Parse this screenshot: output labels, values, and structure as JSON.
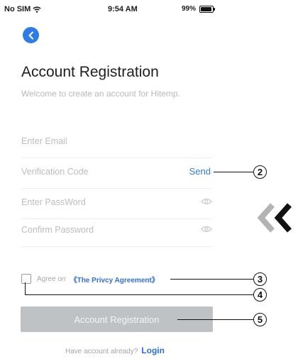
{
  "status_bar": {
    "carrier": "No SIM",
    "time": "9:54 AM",
    "battery": "99%"
  },
  "header": {
    "title": "Account Registration",
    "subtitle": "Welcome to create an account for Hitemp."
  },
  "form": {
    "email_placeholder": "Enter Email",
    "verification_placeholder": "Verification Code",
    "send_label": "Send",
    "password_placeholder": "Enter PassWord",
    "confirm_placeholder": "Confirm Password"
  },
  "agreement": {
    "prefix": "Agree on",
    "link": "《The Privcy Agreement》",
    "checked": false
  },
  "register_button": {
    "label": "Account Registration"
  },
  "login": {
    "prompt": "Have account already?",
    "link": "Login"
  },
  "callouts": [
    "2",
    "3",
    "4",
    "5"
  ],
  "icons": {
    "wifi": "wifi-icon",
    "battery": "battery-icon",
    "back": "chevron-left-icon",
    "eye": "eye-icon",
    "navigate": "double-chevron-left-icon"
  },
  "colors": {
    "accent": "#2e7ce6",
    "link": "#2e6fd8",
    "disabled_button": "#bfc2c5",
    "callout": "#111111"
  }
}
